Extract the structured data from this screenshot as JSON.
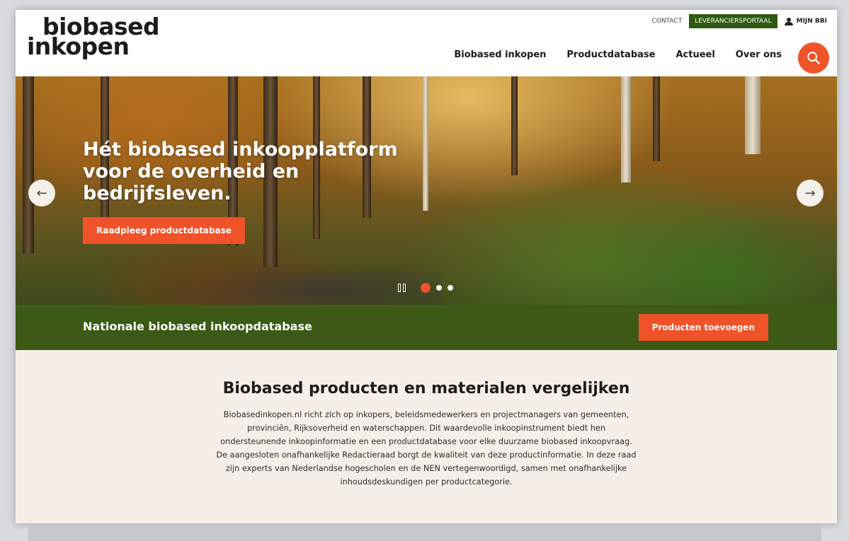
{
  "brand": {
    "logo_line1": "biobased",
    "logo_line2": "inkopen",
    "accent_color": "#f0522a",
    "green_color": "#3c5a15"
  },
  "utility_nav": {
    "contact": "CONTACT",
    "portal": "LEVERANCIERSPORTAAL",
    "account": "MIJN BBI",
    "account_icon": "user-icon"
  },
  "main_nav": {
    "items": [
      "Biobased inkopen",
      "Productdatabase",
      "Actueel",
      "Over ons"
    ],
    "search_icon": "search-icon"
  },
  "hero": {
    "title": "Hét biobased inkoopplatform voor de overheid en bedrijfsleven.",
    "cta": "Raadpleeg productdatabase",
    "prev_icon": "arrow-left-icon",
    "next_icon": "arrow-right-icon",
    "prev_glyph": "←",
    "next_glyph": "→",
    "slides_total": 3,
    "active_slide": 1
  },
  "band": {
    "title": "Nationale biobased inkoopdatabase",
    "cta": "Producten toevoegen"
  },
  "intro": {
    "title": "Biobased producten en materialen vergelijken",
    "text": "Biobasedinkopen.nl richt zich op inkopers, beleidsmedewerkers en projectmanagers van gemeenten, provinciën, Rijksoverheid en waterschappen. Dit waardevolle inkoopinstrument biedt hen ondersteunende inkoopinformatie en een productdatabase voor elke duurzame biobased inkoopvraag. De aangesloten onafhankelijke Redactieraad borgt de kwaliteit van deze productinformatie. In deze raad zijn experts van Nederlandse hogescholen en de NEN vertegenwoordigd, samen met onafhankelijke inhoudsdeskundigen per productcategorie."
  }
}
